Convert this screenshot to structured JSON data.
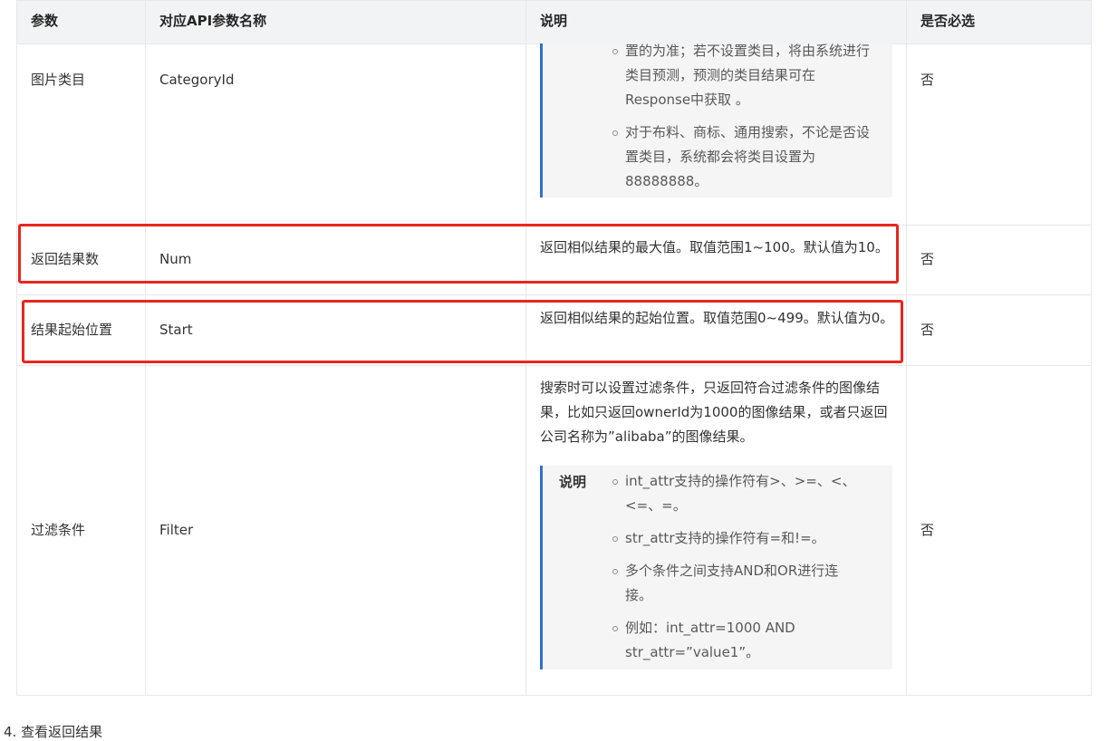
{
  "header": {
    "param": "参数",
    "api_name": "对应API参数名称",
    "desc": "说明",
    "required": "是否必选"
  },
  "rows": [
    {
      "param": "图片类目",
      "api_name": "CategoryId",
      "note_bullets_continued": [
        "置的为准；若不设置类目，将由系统进行类目预测，预测的类目结果可在Response中获取 。"
      ],
      "note_bullets": [
        "对于布料、商标、通用搜索，不论是否设置类目，系统都会将类目设置为88888888。"
      ],
      "required": "否"
    },
    {
      "param": "返回结果数",
      "api_name": "Num",
      "desc": "返回相似结果的最大值。取值范围1~100。默认值为10。",
      "required": "否"
    },
    {
      "param": "结果起始位置",
      "api_name": "Start",
      "desc": "返回相似结果的起始位置。取值范围0~499。默认值为0。",
      "required": "否"
    },
    {
      "param": "过滤条件",
      "api_name": "Filter",
      "desc": "搜索时可以设置过滤条件，只返回符合过滤条件的图像结果，比如只返回ownerId为1000的图像结果，或者只返回公司名称为”alibaba”的图像结果。",
      "note_title": "说明",
      "note_bullets": [
        "int_attr支持的操作符有>、>=、<、<=、=。",
        "str_attr支持的操作符有=和!=。",
        "多个条件之间支持AND和OR进行连接。",
        "例如：int_attr=1000 AND str_attr=”value1”。"
      ],
      "required": "否"
    }
  ],
  "footer_text": "4. 查看返回结果",
  "colors": {
    "highlight": "#e8261d",
    "note_border": "#2f6fd6",
    "note_bg": "#f5f5f5",
    "header_bg": "#f2f3f5"
  }
}
